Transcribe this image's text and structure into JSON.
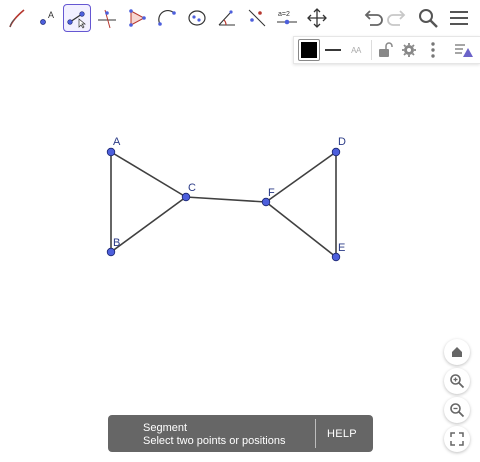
{
  "toolbar": {
    "tools": [
      {
        "name": "pen-tool-icon",
        "active": false
      },
      {
        "name": "point-tool-icon",
        "active": false,
        "label": "A"
      },
      {
        "name": "segment-tool-icon",
        "active": true
      },
      {
        "name": "perpendicular-line-tool-icon",
        "active": false
      },
      {
        "name": "polygon-tool-icon",
        "active": false
      },
      {
        "name": "circle-arc-tool-icon",
        "active": false
      },
      {
        "name": "ellipse-tool-icon",
        "active": false
      },
      {
        "name": "angle-tool-icon",
        "active": false
      },
      {
        "name": "reflect-tool-icon",
        "active": false
      },
      {
        "name": "slider-tool-icon",
        "active": false,
        "label": "a=2"
      },
      {
        "name": "move-view-tool-icon",
        "active": false
      }
    ],
    "right_buttons": [
      "undo-icon",
      "redo-icon",
      "search-icon",
      "menu-icon"
    ]
  },
  "stylebar": {
    "color": "#000000",
    "text_size_label": "AA"
  },
  "points": [
    {
      "label": "A",
      "x": 0,
      "y": 2
    },
    {
      "label": "B",
      "x": 0,
      "y": -2
    },
    {
      "label": "C",
      "x": 3,
      "y": 0.2
    },
    {
      "label": "F",
      "x": 6.2,
      "y": 0
    },
    {
      "label": "D",
      "x": 9,
      "y": 2
    },
    {
      "label": "E",
      "x": 9,
      "y": -2.2
    }
  ],
  "segments": [
    [
      "A",
      "B"
    ],
    [
      "A",
      "C"
    ],
    [
      "B",
      "C"
    ],
    [
      "C",
      "F"
    ],
    [
      "F",
      "D"
    ],
    [
      "F",
      "E"
    ],
    [
      "D",
      "E"
    ]
  ],
  "zoom_buttons": [
    "home-icon",
    "zoom-in-icon",
    "zoom-out-icon",
    "fullscreen-icon"
  ],
  "snackbar": {
    "title": "Segment",
    "message": "Select two points or positions",
    "action": "HELP"
  },
  "colors": {
    "point_fill": "#4d5fdc",
    "point_stroke": "#1b2670",
    "segment": "#404040",
    "active_tool": "#6557d2",
    "snackbar_bg": "#666666"
  }
}
